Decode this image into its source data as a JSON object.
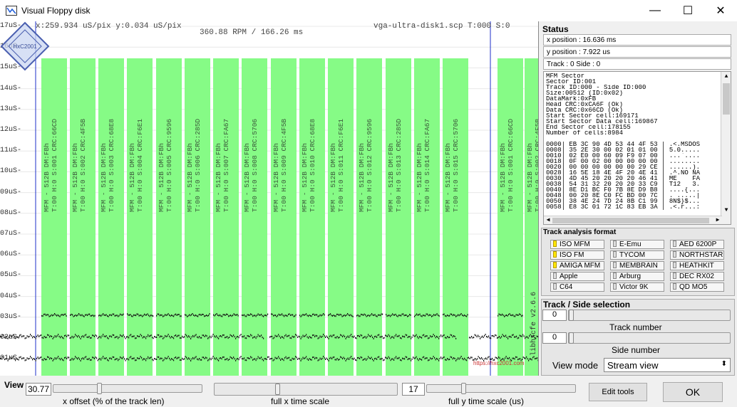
{
  "window": {
    "title": "Visual Floppy disk",
    "minimize": "—",
    "maximize": "☐",
    "close": "✕"
  },
  "stream": {
    "cursor_readout": "x:259.934 uS/pix y:0.034 uS/pix",
    "rpm_readout": "360.88 RPM / 166.26 ms",
    "file_readout": "vga-ultra-disk1.scp T:000 S:0",
    "y_axis_labels": [
      "17uS-",
      "16uS-",
      "15uS-",
      "14uS-",
      "13uS-",
      "12uS-",
      "11uS-",
      "10uS-",
      "09uS-",
      "08uS-",
      "07uS-",
      "06uS-",
      "05uS-",
      "04uS-",
      "03uS-",
      "02uS-",
      "01uS-"
    ],
    "sectors": [
      {
        "line1": "MFM - 512B DM:FBh",
        "line2": "T:00 H:0 S:001 CRC:66CD"
      },
      {
        "line1": "MFM - 512B DM:FBh",
        "line2": "T:00 H:0 S:002 CRC:4F5B"
      },
      {
        "line1": "MFM - 512B DM:FBh",
        "line2": "T:00 H:0 S:003 CRC:68E8"
      },
      {
        "line1": "MFM - 512B DM:FBh",
        "line2": "T:00 H:0 S:004 CRC:F6E1"
      },
      {
        "line1": "MFM - 512B DM:FBh",
        "line2": "T:00 H:0 S:005 CRC:9596"
      },
      {
        "line1": "MFM - 512B DM:FBh",
        "line2": "T:00 H:0 S:006 CRC:285D"
      },
      {
        "line1": "MFM - 512B DM:FBh",
        "line2": "T:00 H:0 S:007 CRC:FA67"
      },
      {
        "line1": "MFM - 512B DM:FBh",
        "line2": "T:00 H:0 S:008 CRC:5706"
      },
      {
        "line1": "MFM - 512B DM:FBh",
        "line2": "T:00 H:0 S:009 CRC:4F5B"
      },
      {
        "line1": "MFM - 512B DM:FBh",
        "line2": "T:00 H:0 S:010 CRC:68E8"
      },
      {
        "line1": "MFM - 512B DM:FBh",
        "line2": "T:00 H:0 S:011 CRC:F6E1"
      },
      {
        "line1": "MFM - 512B DM:FBh",
        "line2": "T:00 H:0 S:012 CRC:9596"
      },
      {
        "line1": "MFM - 512B DM:FBh",
        "line2": "T:00 H:0 S:013 CRC:285D"
      },
      {
        "line1": "MFM - 512B DM:FBh",
        "line2": "T:00 H:0 S:014 CRC:FA67"
      },
      {
        "line1": "MFM - 512B DM:FBh",
        "line2": "T:00 H:0 S:015 CRC:5706"
      },
      {
        "line1": "MFM - 512B DM:FBh",
        "line2": "T:00 H:0 S:001 CRC:66CD"
      },
      {
        "line1": "MFM - 512B DM:FBh",
        "line2": "T:00 H:0 S:002 CRC:4F5B"
      }
    ],
    "version_label": "libhxcfe v2.6.6",
    "watermark_text": "HxC2001",
    "watermark_url": "https://hxc2001.com"
  },
  "status": {
    "title": "Status",
    "x_position": "x position : 16.636 ms",
    "y_position": "y position : 7.922 us",
    "track_side": "Track : 0 Side : 0",
    "info_lines": [
      "MFM Sector",
      "Sector ID:001",
      "Track ID:000 - Side ID:000",
      "Size:00512 (ID:0x02)",
      "DataMark:0xFB",
      "Head CRC:0xCA6F (Ok)",
      "Data CRC:0x66CD (Ok)",
      "Start Sector cell:169171",
      "Start Sector Data cell:169867",
      "End Sector cell:178155",
      "Number of cells:8984"
    ],
    "hex_lines": [
      "0000| EB 3C 90 4D 53 44 4F 53 | .<.MSDOS",
      "0008| 35 2E 30 00 02 01 01 00 | 5.0.....",
      "0010| 02 E0 00 60 09 F9 07 00 | ...`....",
      "0018| 0F 00 02 00 00 00 00 00 | ........",
      "0020| 00 00 00 00 00 00 29 CE | ......).",
      "0028| 16 5E 18 4E 4F 20 4E 41 | .^.NO NA",
      "0030| 4D 45 20 20 20 20 46 41 | ME    FA",
      "0038| 54 31 32 20 20 20 33 C9 | T12   3.",
      "0040| 8E D1 BC F0 7B 8E D9 B8 | ....{...",
      "0048| 00 20 8E C0 FC BD 00 7C | . .....|",
      "0050| 38 4E 24 7D 24 8B C1 99 | 8N$}$...",
      "0058| E8 3C 01 72 1C 83 EB 3A | .<.r...:"
    ]
  },
  "track_format": {
    "title": "Track analysis format",
    "buttons": [
      {
        "label": "ISO MFM",
        "on": true
      },
      {
        "label": "E-Emu",
        "on": false
      },
      {
        "label": "AED 6200P",
        "on": false
      },
      {
        "label": "ISO FM",
        "on": true
      },
      {
        "label": "TYCOM",
        "on": false
      },
      {
        "label": "NORTHSTAR",
        "on": false
      },
      {
        "label": "AMIGA MFM",
        "on": true
      },
      {
        "label": "MEMBRAIN",
        "on": false
      },
      {
        "label": "HEATHKIT",
        "on": false
      },
      {
        "label": "Apple",
        "on": false
      },
      {
        "label": "Arburg",
        "on": false
      },
      {
        "label": "DEC RX02",
        "on": false
      },
      {
        "label": "C64",
        "on": false
      },
      {
        "label": "Victor 9K",
        "on": false
      },
      {
        "label": "QD MO5",
        "on": false
      }
    ]
  },
  "track_side": {
    "title": "Track / Side selection",
    "track_value": "0",
    "track_label": "Track number",
    "side_value": "0",
    "side_label": "Side number",
    "view_mode_label": "View mode",
    "view_mode_value": "Stream view"
  },
  "view": {
    "title": "View",
    "x_offset_value": "30.77",
    "x_offset_label": "x offset (% of the track len)",
    "x_offset_level": 0.3077,
    "x_time_label": "full x time scale",
    "y_time_value": "17",
    "y_time_label": "full y time scale (us)",
    "edit_tools": "Edit tools",
    "ok": "OK"
  }
}
